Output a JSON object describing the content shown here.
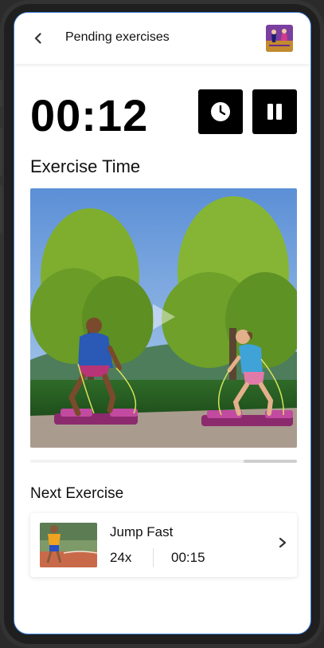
{
  "header": {
    "title": "Pending exercises",
    "back_icon": "chevron-left-icon"
  },
  "timer": {
    "value": "00:12"
  },
  "controls": {
    "clock_icon": "clock-icon",
    "pause_icon": "pause-icon"
  },
  "current_exercise": {
    "section_title": "Exercise Time",
    "progress_fraction": 0.2
  },
  "next_exercise": {
    "section_title": "Next Exercise",
    "name": "Jump Fast",
    "reps": "24x",
    "duration": "00:15"
  },
  "colors": {
    "accent": "#000000",
    "screen_border": "#3a7bd5"
  }
}
